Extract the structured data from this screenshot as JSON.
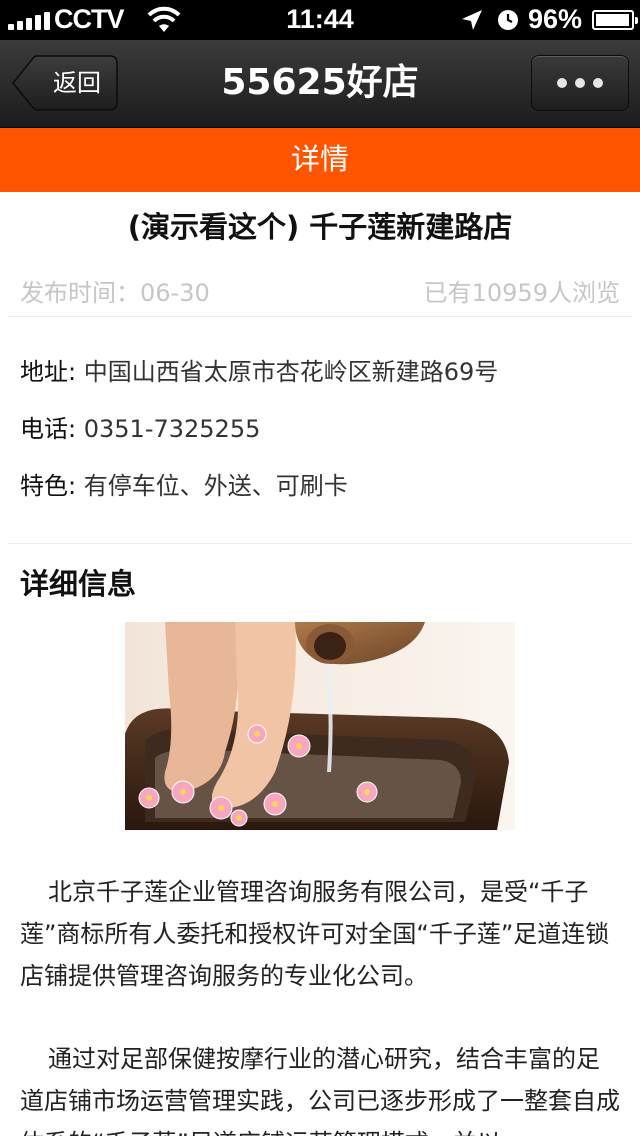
{
  "status_bar": {
    "carrier": "CCTV",
    "time": "11:44",
    "battery": "96%",
    "battery_level": 0.96
  },
  "nav": {
    "back_label": "返回",
    "title": "55625好店"
  },
  "tab": {
    "label": "详情"
  },
  "store": {
    "title": "(演示看这个) 千子莲新建路店",
    "publish_time": "发布时间：06-30",
    "views": "已有10959人浏览",
    "address_key": "地址:",
    "address_value": "中国山西省太原市杏花岭区新建路69号",
    "phone_key": "电话:",
    "phone_value": "0351-7325255",
    "feature_key": "特色:",
    "feature_value": "有停车位、外送、可刷卡"
  },
  "details": {
    "heading": "详细信息",
    "paragraph_1": "北京千子莲企业管理咨询服务有限公司，是受“千子莲”商标所有人委托和授权许可对全国“千子莲”足道连锁店铺提供管理咨询服务的专业化公司。",
    "paragraph_2": "通过对足部保健按摩行业的潜心研究，结合丰富的足道店铺市场运营管理实践，公司已逐步形成了一整套自成体系的“千子莲”足道店铺运营管理模式，并以"
  },
  "colors": {
    "accent": "#ff5500",
    "nav_background": "#2b2b2b",
    "meta_text": "#c6c6c6"
  }
}
